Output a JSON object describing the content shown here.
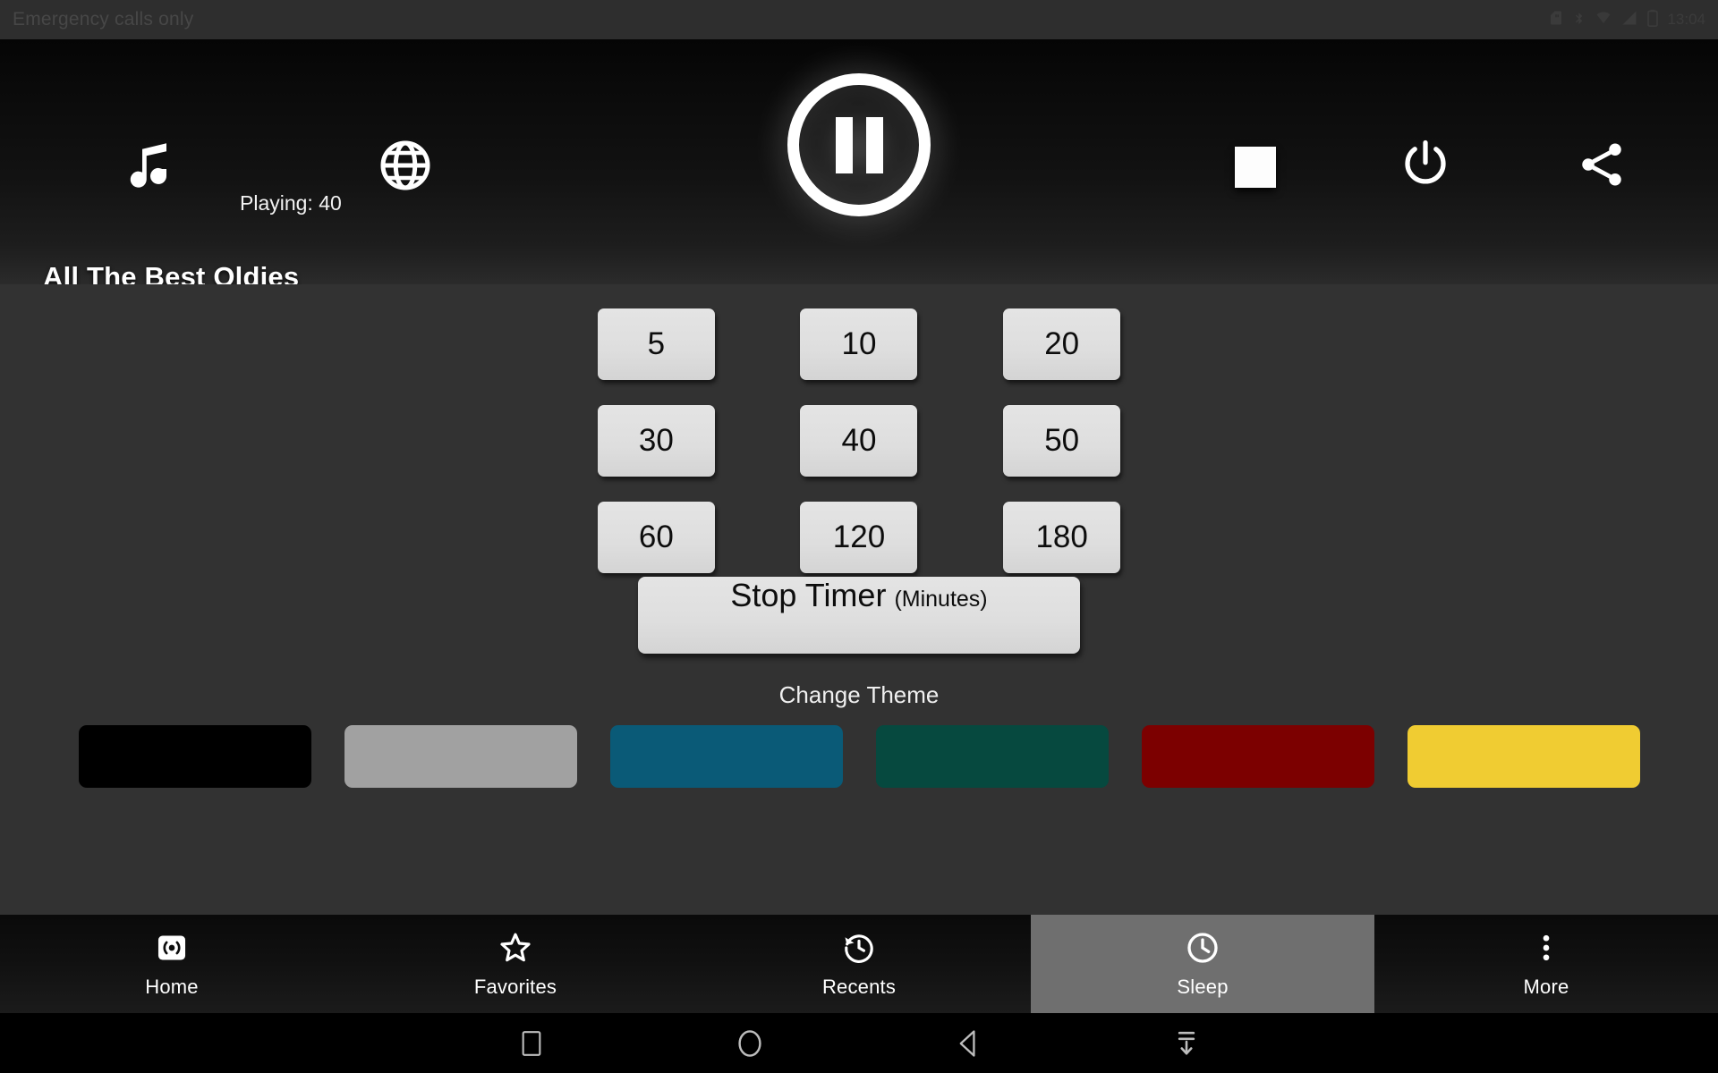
{
  "system": {
    "status_text": "Emergency calls only",
    "status_icons": [
      "sd-icon",
      "wifi-icon",
      "bluetooth-icon",
      "signal-icon",
      "battery-icon"
    ],
    "status_time": "13:04"
  },
  "header": {
    "toolbar": [
      {
        "name": "music-library-button",
        "icon": "music-note-icon"
      },
      {
        "name": "globe-button",
        "icon": "globe-icon"
      },
      {
        "name": "play-pause-button",
        "icon": "pause-icon"
      },
      {
        "name": "stop-button",
        "icon": "stop-square-icon"
      },
      {
        "name": "power-button",
        "icon": "power-icon"
      },
      {
        "name": "share-button",
        "icon": "share-icon"
      }
    ],
    "playing_label": "Playing: 40",
    "station_title": "All The Best Oldies"
  },
  "sleep_timer": {
    "options": [
      "5",
      "10",
      "20",
      "30",
      "40",
      "50",
      "60",
      "120",
      "180"
    ],
    "stop_main_label": "Stop Timer",
    "stop_sub_label": "(Minutes)"
  },
  "theme": {
    "heading": "Change Theme",
    "swatches": [
      {
        "name": "theme-black",
        "color": "#000000"
      },
      {
        "name": "theme-gray",
        "color": "#a1a1a1"
      },
      {
        "name": "theme-blue",
        "color": "#0a5a77"
      },
      {
        "name": "theme-green",
        "color": "#06493f"
      },
      {
        "name": "theme-red",
        "color": "#7c0000"
      },
      {
        "name": "theme-yellow",
        "color": "#f0cc32"
      }
    ]
  },
  "tabs": [
    {
      "label": "Home",
      "icon": "radio-broadcast-icon",
      "active": false
    },
    {
      "label": "Favorites",
      "icon": "star-outline-icon",
      "active": false
    },
    {
      "label": "Recents",
      "icon": "history-clock-icon",
      "active": false
    },
    {
      "label": "Sleep",
      "icon": "clock-icon",
      "active": true
    },
    {
      "label": "More",
      "icon": "overflow-dots-icon",
      "active": false
    }
  ],
  "navbar": [
    {
      "name": "recents-nav-button",
      "icon": "square-icon"
    },
    {
      "name": "home-nav-button",
      "icon": "circle-icon"
    },
    {
      "name": "back-nav-button",
      "icon": "triangle-left-icon"
    },
    {
      "name": "hide-nav-button",
      "icon": "collapse-down-icon"
    }
  ]
}
